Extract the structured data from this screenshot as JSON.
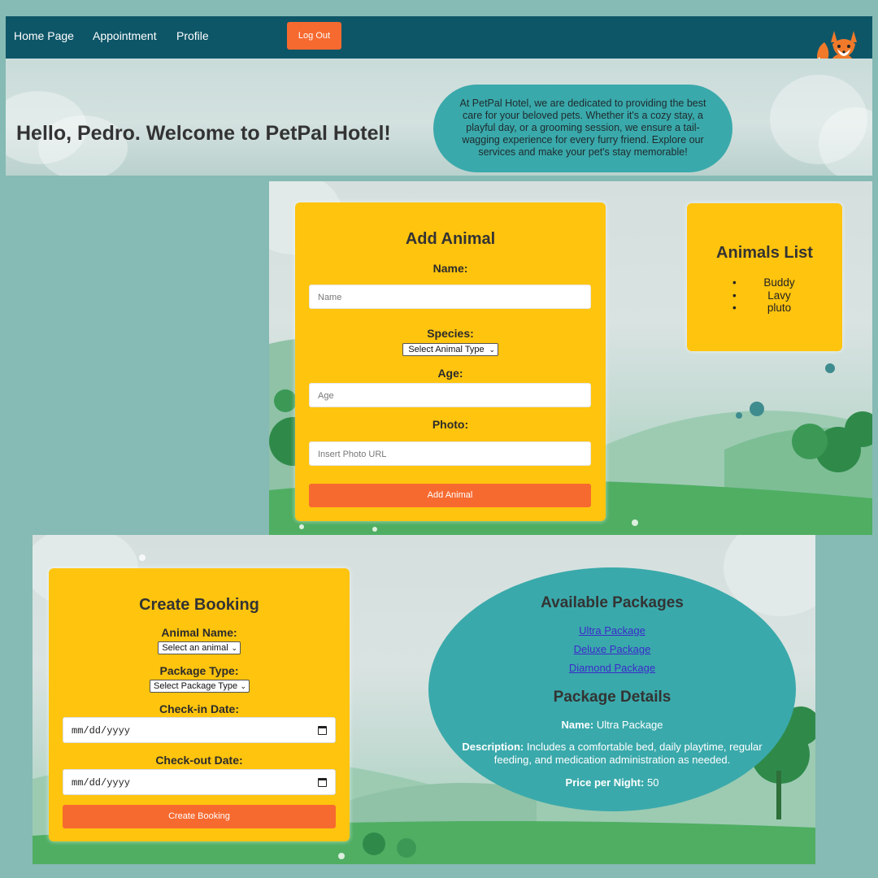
{
  "nav": {
    "links": [
      "Home Page",
      "Appointment",
      "Profile"
    ],
    "logout_label": "Log Out"
  },
  "hero": {
    "title": "Hello, Pedro. Welcome to PetPal Hotel!",
    "description": "At PetPal Hotel, we are dedicated to providing the best care for your beloved pets. Whether it's a cozy stay, a playful day, or a grooming session, we ensure a tail-wagging experience for every furry friend. Explore our services and make your pet's stay memorable!"
  },
  "add_animal": {
    "title": "Add Animal",
    "name_label": "Name:",
    "name_placeholder": "Name",
    "species_label": "Species:",
    "species_select": "Select Animal Type",
    "age_label": "Age:",
    "age_placeholder": "Age",
    "photo_label": "Photo:",
    "photo_placeholder": "Insert Photo URL",
    "submit_label": "Add Animal"
  },
  "animals_list": {
    "title": "Animals List",
    "items": [
      "Buddy",
      "Lavy",
      "pluto"
    ]
  },
  "booking": {
    "title": "Create Booking",
    "animal_label": "Animal Name:",
    "animal_select": "Select an animal",
    "package_label": "Package Type:",
    "package_select": "Select Package Type",
    "checkin_label": "Check-in Date:",
    "checkin_value": "mm/dd/yyyy",
    "checkout_label": "Check-out Date:",
    "checkout_value": "mm/dd/yyyy",
    "submit_label": "Create Booking"
  },
  "packages": {
    "title": "Available Packages",
    "links": [
      "Ultra Package",
      "Deluxe Package",
      "Diamond Package"
    ],
    "details_title": "Package Details",
    "name_key": "Name:",
    "name_value": "Ultra Package",
    "desc_key": "Description:",
    "desc_value_1": "Includes a comfortable bed, daily playtime, regular",
    "desc_value_2": "feeding, and medication administration as needed.",
    "price_key": "Price per Night:",
    "price_value": "50"
  },
  "colors": {
    "nav": "#0d5668",
    "card": "#ffc40e",
    "button": "#f66a30",
    "bubble": "#3aa9ab",
    "page": "#86bab4"
  }
}
